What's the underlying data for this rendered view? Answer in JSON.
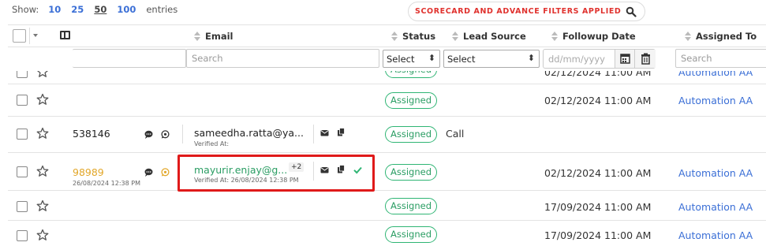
{
  "show": {
    "label": "Show:",
    "options": [
      "10",
      "25",
      "50",
      "100"
    ],
    "selected": "50",
    "suffix": "entries"
  },
  "filter_banner": {
    "text": "SCORECARD AND ADVANCE FILTERS APPLIED",
    "icon": "search-icon"
  },
  "columns": {
    "email": "Email",
    "status": "Status",
    "lead_source": "Lead Source",
    "followup": "Followup Date",
    "assigned_to": "Assigned To"
  },
  "filters": {
    "email_placeholder": "Search",
    "status_select": "Select",
    "lead_source_select": "Select",
    "date_placeholder": "dd/mm/yyyy",
    "assigned_placeholder": "Search"
  },
  "rows": [
    {
      "status": "Assigned",
      "followup": "02/12/2024 11:00 AM",
      "assigned": "Automation AA"
    },
    {
      "status": "Assigned",
      "followup": "02/12/2024 11:00 AM",
      "assigned": "Automation AA"
    },
    {
      "phone": "538146",
      "email": "sameedha.ratta@ya...",
      "verified": "Verified At:",
      "status": "Assigned",
      "lead_source": "Call"
    },
    {
      "phone": "98989",
      "phone_sub": "26/08/2024 12:38 PM",
      "email": "mayurir.enjay@g...",
      "email_extra": "+2",
      "verified": "Verified At: 26/08/2024 12:38 PM",
      "status": "Assigned",
      "followup": "02/12/2024 11:00 AM",
      "assigned": "Automation AA"
    },
    {
      "status": "Assigned",
      "followup": "17/09/2024 11:00 AM",
      "assigned": "Automation AA"
    },
    {
      "status": "Assigned",
      "followup": "17/09/2024 11:00 AM",
      "assigned": "Automation AA"
    }
  ],
  "colors": {
    "accent_blue": "#3b6fd6",
    "status_green": "#2a9d63",
    "alert_red": "#e0322e",
    "highlight_box": "#e01a1a",
    "phone_highlight": "#e2a72a"
  }
}
